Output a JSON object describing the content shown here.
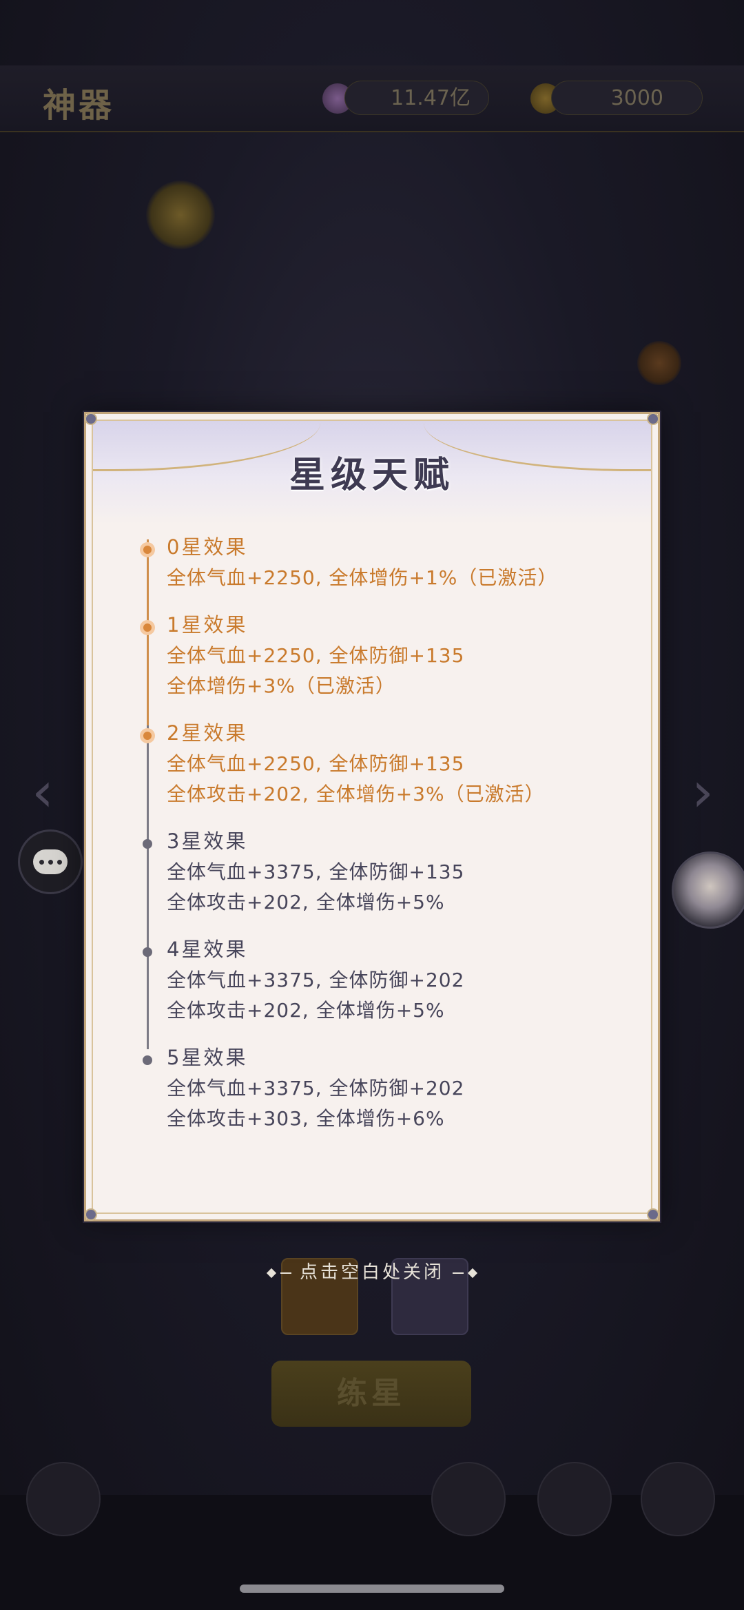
{
  "background": {
    "screen_title": "神器",
    "resource_1": "11.47亿",
    "resource_2": "3000",
    "action_button": "练星"
  },
  "dialog": {
    "title": "星级天赋",
    "tiers": [
      {
        "label": "0星效果",
        "active": true,
        "lines": [
          "全体气血+2250, 全体增伤+1%（已激活）"
        ]
      },
      {
        "label": "1星效果",
        "active": true,
        "lines": [
          "全体气血+2250, 全体防御+135",
          "全体增伤+3%（已激活）"
        ]
      },
      {
        "label": "2星效果",
        "active": true,
        "lines": [
          "全体气血+2250, 全体防御+135",
          "全体攻击+202, 全体增伤+3%（已激活）"
        ]
      },
      {
        "label": "3星效果",
        "active": false,
        "lines": [
          "全体气血+3375, 全体防御+135",
          "全体攻击+202, 全体增伤+5%"
        ]
      },
      {
        "label": "4星效果",
        "active": false,
        "lines": [
          "全体气血+3375, 全体防御+202",
          "全体攻击+202, 全体增伤+5%"
        ]
      },
      {
        "label": "5星效果",
        "active": false,
        "lines": [
          "全体气血+3375, 全体防御+202",
          "全体攻击+303, 全体增伤+6%"
        ]
      }
    ]
  },
  "close_hint": "点击空白处关闭",
  "colors": {
    "active_text": "#c97a2c",
    "inactive_text": "#47455a",
    "dialog_bg": "#f7f1ee"
  }
}
